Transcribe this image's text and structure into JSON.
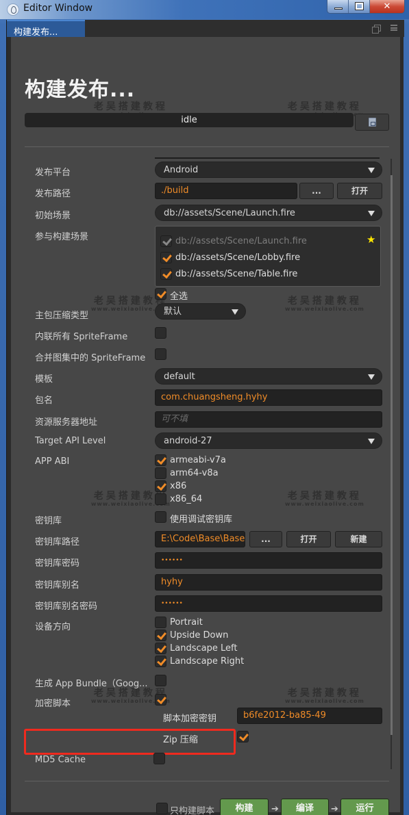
{
  "window": {
    "title": "Editor Window",
    "controls": [
      "minimize",
      "maximize",
      "close"
    ]
  },
  "tab": {
    "label": "构建发布...",
    "icons": [
      "popout-icon",
      "menu-icon"
    ]
  },
  "header": {
    "title": "构建发布...",
    "status": "idle",
    "log_button_icon": "log-file-icon"
  },
  "watermark": {
    "cn": "老吴搭建教程",
    "en": "www.weixiaolive.com"
  },
  "form": {
    "platform": {
      "label": "发布平台",
      "value": "Android"
    },
    "build_path": {
      "label": "发布路径",
      "value": "./build",
      "browse_label": "...",
      "open_label": "打开"
    },
    "start_scene": {
      "label": "初始场景",
      "value": "db://assets/Scene/Launch.fire"
    },
    "scenes": {
      "label": "参与构建场景",
      "items": [
        {
          "path": "db://assets/Scene/Launch.fire",
          "checked": true,
          "disabled": true,
          "starred": true
        },
        {
          "path": "db://assets/Scene/Lobby.fire",
          "checked": true,
          "disabled": false,
          "starred": false
        },
        {
          "path": "db://assets/Scene/Table.fire",
          "checked": true,
          "disabled": false,
          "starred": false
        }
      ],
      "select_all_label": "全选",
      "select_all_checked": true
    },
    "compression": {
      "label": "主包压缩类型",
      "value": "默认"
    },
    "inline_spriteframes": {
      "label": "内联所有 SpriteFrame",
      "checked": false
    },
    "merge_spriteframes": {
      "label": "合并图集中的 SpriteFrame",
      "checked": false
    },
    "template": {
      "label": "模板",
      "value": "default"
    },
    "package_name": {
      "label": "包名",
      "value": "com.chuangsheng.hyhy"
    },
    "server_address": {
      "label": "资源服务器地址",
      "value": "",
      "placeholder": "可不填"
    },
    "target_api": {
      "label": "Target API Level",
      "value": "android-27"
    },
    "app_abi": {
      "label": "APP ABI",
      "options": [
        {
          "name": "armeabi-v7a",
          "checked": true
        },
        {
          "name": "arm64-v8a",
          "checked": false
        },
        {
          "name": "x86",
          "checked": true
        },
        {
          "name": "x86_64",
          "checked": false
        }
      ]
    },
    "keystore": {
      "label": "密钥库",
      "debug_label": "使用调试密钥库",
      "debug_checked": false
    },
    "keystore_path": {
      "label": "密钥库路径",
      "value": "E:\\Code\\Base\\Base",
      "browse_label": "...",
      "open_label": "打开",
      "new_label": "新建"
    },
    "keystore_password": {
      "label": "密钥库密码",
      "value": "••••••"
    },
    "keystore_alias": {
      "label": "密钥库别名",
      "value": "hyhy"
    },
    "alias_password": {
      "label": "密钥库别名密码",
      "value": "••••••"
    },
    "orientation": {
      "label": "设备方向",
      "options": [
        {
          "name": "Portrait",
          "checked": false
        },
        {
          "name": "Upside Down",
          "checked": true
        },
        {
          "name": "Landscape Left",
          "checked": true
        },
        {
          "name": "Landscape Right",
          "checked": true
        }
      ]
    },
    "app_bundle": {
      "label": "生成 App Bundle（Goog...",
      "checked": false
    },
    "encrypt_js": {
      "label": "加密脚本",
      "checked": true,
      "key_label": "脚本加密密钥",
      "key_value": "b6fe2012-ba85-49",
      "zip_label": "Zip 压缩",
      "zip_checked": true
    },
    "md5_cache": {
      "label": "MD5 Cache",
      "checked": false
    }
  },
  "footer": {
    "build_script_only_label": "只构建脚本",
    "build_script_only_checked": false,
    "build_label": "构建",
    "compile_label": "编译",
    "run_label": "运行",
    "arrow": "➔"
  },
  "colors": {
    "accent": "#f08c28",
    "action_green": "#63994d",
    "highlight_red": "#f02a1e",
    "panel_bg": "#474747"
  }
}
